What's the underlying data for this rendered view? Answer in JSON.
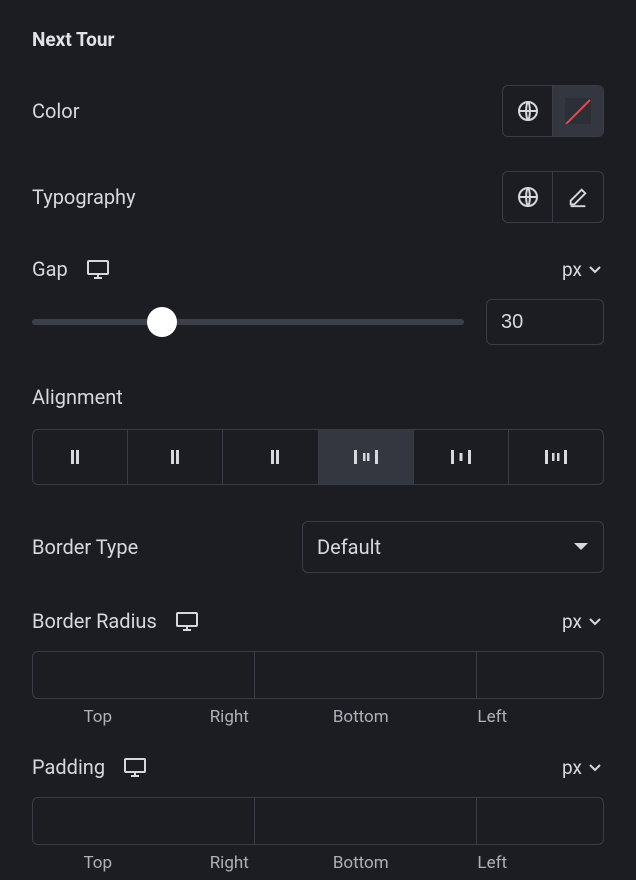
{
  "section_title": "Next Tour",
  "color": {
    "label": "Color"
  },
  "typography": {
    "label": "Typography"
  },
  "gap": {
    "label": "Gap",
    "unit": "px",
    "value": "30",
    "percent": 30
  },
  "alignment": {
    "label": "Alignment",
    "selected_index": 3
  },
  "border_type": {
    "label": "Border Type",
    "value": "Default"
  },
  "border_radius": {
    "label": "Border Radius",
    "unit": "px",
    "sides": {
      "top": "Top",
      "right": "Right",
      "bottom": "Bottom",
      "left": "Left"
    }
  },
  "padding": {
    "label": "Padding",
    "unit": "px",
    "sides": {
      "top": "Top",
      "right": "Right",
      "bottom": "Bottom",
      "left": "Left"
    }
  }
}
